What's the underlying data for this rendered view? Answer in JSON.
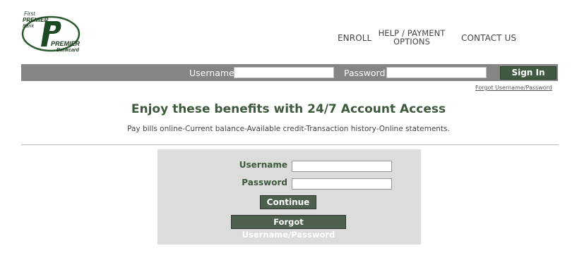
{
  "logo": {
    "line1": "First",
    "line2": "PREMIER",
    "line3": "Bank",
    "line4": "PREMIER",
    "line5": "Bankcard"
  },
  "nav": {
    "enroll": "ENROLL",
    "help_line1": "HELP / PAYMENT",
    "help_line2": "OPTIONS",
    "contact": "CONTACT US"
  },
  "signbar": {
    "username_label": "Username:",
    "password_label": "Password:",
    "signin_label": "Sign In",
    "forgot_link": "Forgot Username/Password"
  },
  "main": {
    "headline": "Enjoy these benefits with 24/7 Account Access",
    "subline": "Pay bills online-Current balance-Available credit-Transaction history-Online statements."
  },
  "login_panel": {
    "username_label": "Username",
    "password_label": "Password",
    "continue_label": "Continue",
    "forgot_label": "Forgot Username/Password"
  },
  "colors": {
    "brand_green": "#3d5a3d",
    "bar_gray": "#858585",
    "panel_gray": "#dcdcdc",
    "button_green": "#4d5f4d"
  }
}
